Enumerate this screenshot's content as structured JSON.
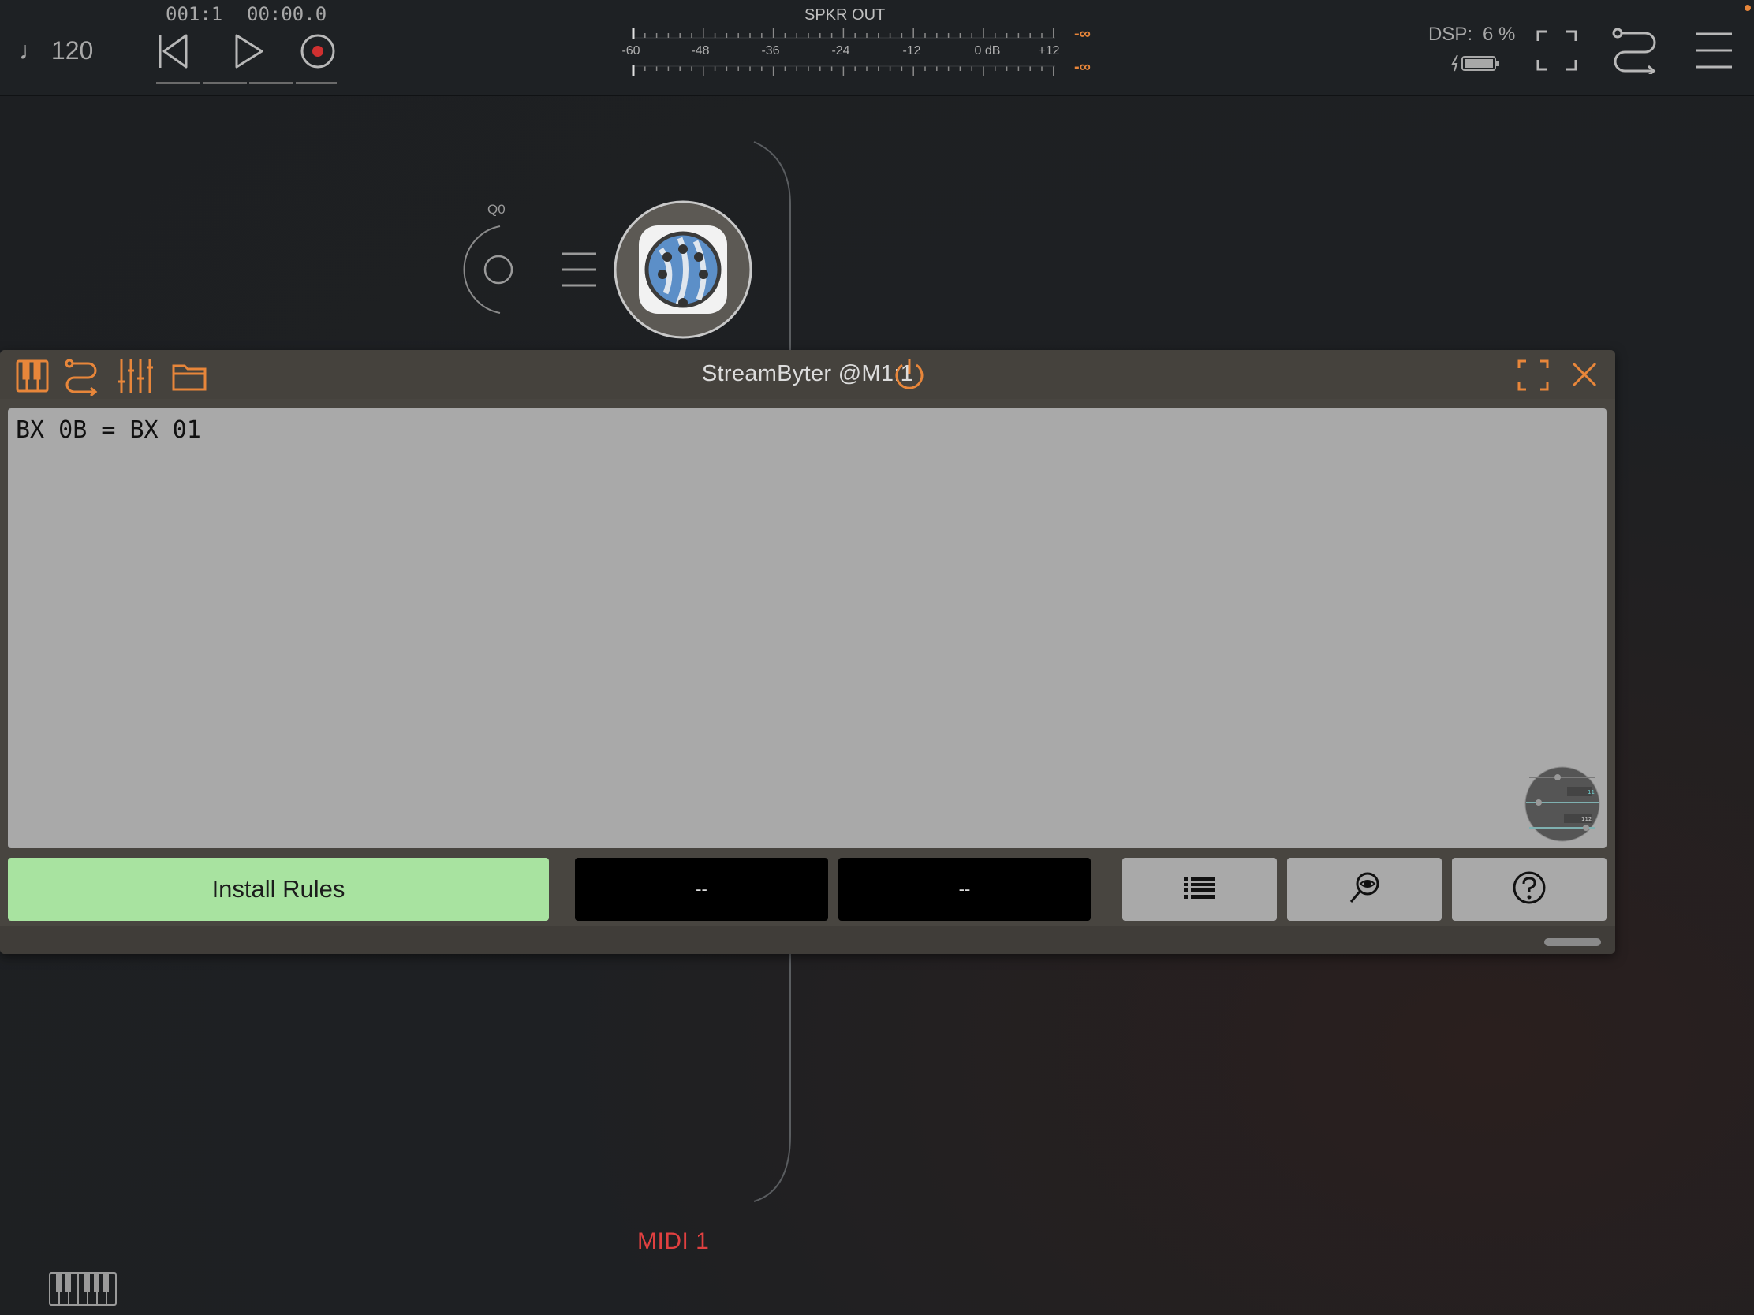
{
  "topbar": {
    "tempo": "♩ 120",
    "position": "001:1",
    "time": "00:00.0",
    "meter_title": "SPKR OUT",
    "meter_ticks": [
      "-60",
      "-48",
      "-36",
      "-24",
      "-12",
      "0 dB",
      "+12"
    ],
    "meter_peak_top": "-∞",
    "meter_peak_bottom": "-∞",
    "dsp_label": "DSP:",
    "dsp_value": "6 %"
  },
  "node": {
    "knob_value": "Q0",
    "midi_label": "MIDI 1"
  },
  "panel": {
    "title": "StreamByter @M1:1",
    "editor_text": "BX 0B = BX 01",
    "install_label": "Install Rules",
    "display_a": "--",
    "display_b": "--",
    "thumb_values": [
      "11",
      "112"
    ]
  },
  "colors": {
    "accent": "#e8863a",
    "install_bg": "#a8e3a0",
    "midi_label": "#e04040",
    "record": "#d03030"
  }
}
